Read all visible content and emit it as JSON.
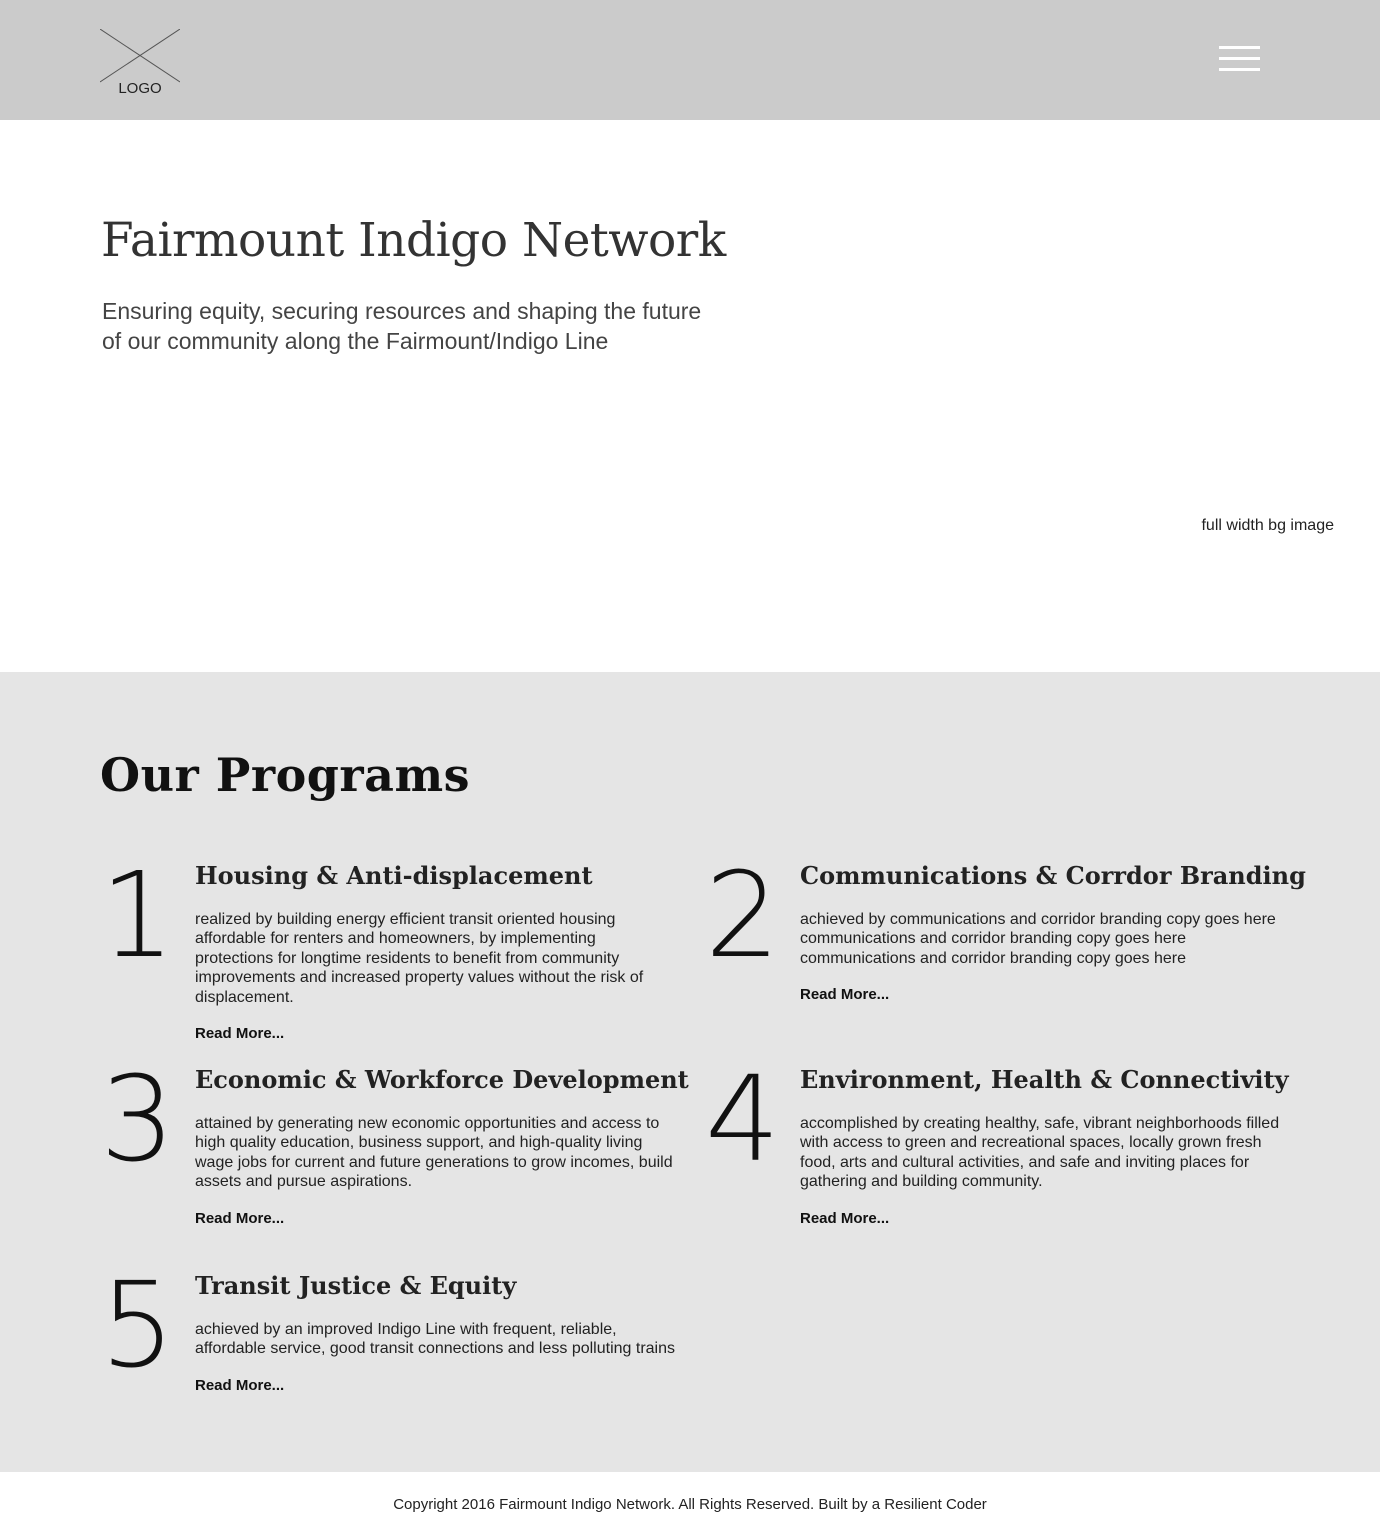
{
  "header": {
    "logo_text": "LOGO",
    "menu_icon": "hamburger-menu-icon",
    "background_color": "#cbcbcb"
  },
  "hero": {
    "title": "Fairmount Indigo Network",
    "subtitle": "Ensuring equity, securing resources and shaping the future of our community along the Fairmount/Indigo Line",
    "bg_note": "full width bg image"
  },
  "programs": {
    "heading": "Our Programs",
    "background_color": "#e5e5e5",
    "items": [
      {
        "number": "1",
        "title": "Housing & Anti-displacement",
        "text": "realized by building energy efficient transit oriented housing affordable for renters and homeowners, by implementing protections for longtime residents to benefit from community improvements and increased property values without the risk of displacement.",
        "link": "Read More..."
      },
      {
        "number": "2",
        "title": "Communications & Corrdor Branding",
        "text": "achieved by communications and corridor branding copy goes here communications and corridor branding copy goes here communications and corridor branding copy goes here",
        "link": "Read More..."
      },
      {
        "number": "3",
        "title": "Economic & Workforce Development",
        "text": "attained by generating new economic opportunities and access to high quality education, business support, and high-quality living wage jobs for current and future generations to grow incomes, build assets and pursue aspirations.",
        "link": "Read More..."
      },
      {
        "number": "4",
        "title": "Environment, Health & Connectivity",
        "text": "accomplished by creating healthy, safe, vibrant neighborhoods filled with access to green and recreational spaces, locally grown fresh food, arts and cultural activities, and safe and inviting places for gathering and building community.",
        "link": "Read More..."
      },
      {
        "number": "5",
        "title": "Transit Justice & Equity",
        "text": "achieved by an improved Indigo Line with frequent, reliable, affordable service, good transit connections and less polluting trains",
        "link": "Read More..."
      }
    ]
  },
  "footer": {
    "text": "Copyright 2016 Fairmount Indigo Network. All Rights Reserved. Built by a Resilient Coder"
  }
}
